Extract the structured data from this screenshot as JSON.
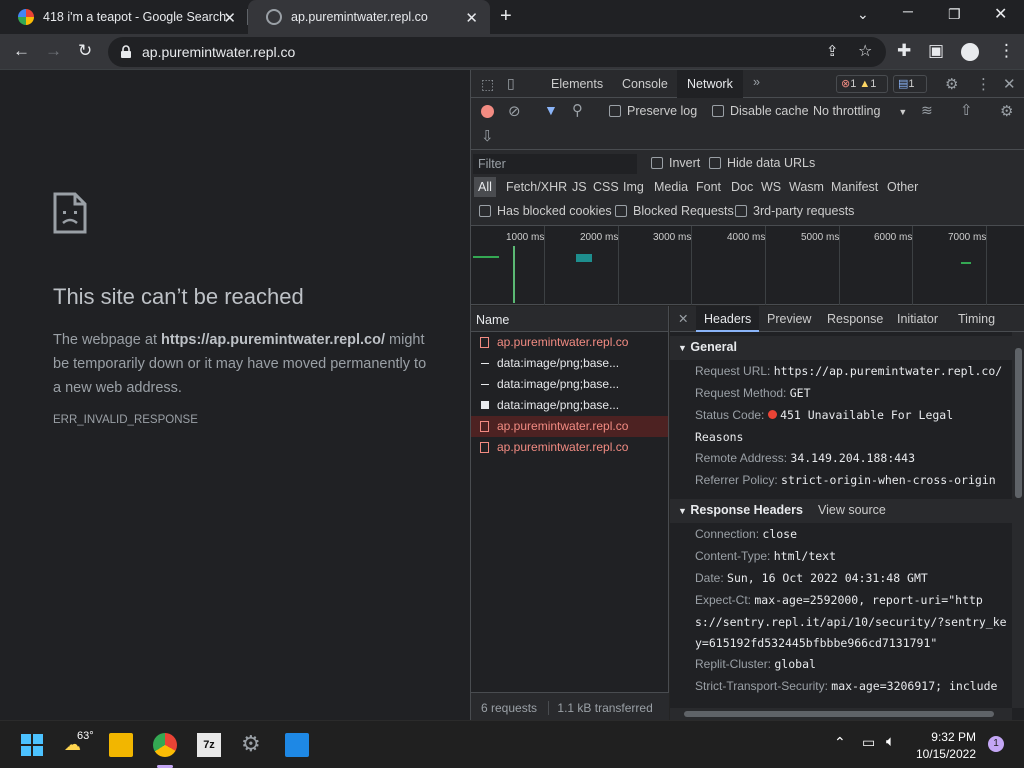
{
  "tabs": [
    {
      "title": "418 i'm a teapot - Google Search"
    },
    {
      "title": "ap.puremintwater.repl.co"
    }
  ],
  "toolbar": {
    "url": "ap.puremintwater.repl.co"
  },
  "page": {
    "title": "This site can’t be reached",
    "body_prefix": "The webpage at ",
    "body_url": "https://ap.puremintwater.repl.co/",
    "body_suffix": " might be temporarily down or it may have moved permanently to a new web address.",
    "error_code": "ERR_INVALID_RESPONSE"
  },
  "devtools": {
    "tabs": [
      "Elements",
      "Console",
      "Network"
    ],
    "active_tab": "Network",
    "badges": {
      "errors": "1",
      "warnings": "1",
      "messages": "1"
    },
    "toolbar": {
      "preserve_log": "Preserve log",
      "disable_cache": "Disable cache",
      "throttling": "No throttling"
    },
    "filter": {
      "placeholder": "Filter",
      "invert": "Invert",
      "hide_data_urls": "Hide data URLs",
      "types": [
        "All",
        "Fetch/XHR",
        "JS",
        "CSS",
        "Img",
        "Media",
        "Font",
        "Doc",
        "WS",
        "Wasm",
        "Manifest",
        "Other"
      ],
      "has_blocked_cookies": "Has blocked cookies",
      "blocked_requests": "Blocked Requests",
      "third_party": "3rd-party requests"
    },
    "timeline": {
      "ticks": [
        "1000 ms",
        "2000 ms",
        "3000 ms",
        "4000 ms",
        "5000 ms",
        "6000 ms",
        "7000 ms"
      ]
    },
    "requests": {
      "header": "Name",
      "items": [
        {
          "name": "ap.puremintwater.repl.co",
          "kind": "error"
        },
        {
          "name": "data:image/png;base...",
          "kind": "data"
        },
        {
          "name": "data:image/png;base...",
          "kind": "data"
        },
        {
          "name": "data:image/png;base...",
          "kind": "data-white"
        },
        {
          "name": "ap.puremintwater.repl.co",
          "kind": "error-selected"
        },
        {
          "name": "ap.puremintwater.repl.co",
          "kind": "error"
        }
      ],
      "summary_count": "6 requests",
      "summary_transfer": "1.1 kB transferred"
    },
    "detail": {
      "tabs": [
        "Headers",
        "Preview",
        "Response",
        "Initiator",
        "Timing"
      ],
      "general_title": "General",
      "general": [
        {
          "key": "Request URL:",
          "value": "https://ap.puremintwater.repl.co/"
        },
        {
          "key": "Request Method:",
          "value": "GET"
        },
        {
          "key": "Status Code:",
          "value": "451 Unavailable For Legal Reasons"
        },
        {
          "key": "Remote Address:",
          "value": "34.149.204.188:443"
        },
        {
          "key": "Referrer Policy:",
          "value": "strict-origin-when-cross-origin"
        }
      ],
      "response_title": "Response Headers",
      "view_source": "View source",
      "response": [
        {
          "key": "Connection:",
          "value": "close"
        },
        {
          "key": "Content-Type:",
          "value": "html/text"
        },
        {
          "key": "Date:",
          "value": "Sun, 16 Oct 2022 04:31:48 GMT"
        },
        {
          "key": "Expect-Ct:",
          "value": "max-age=2592000, report-uri=\"https://sentry.repl.it/api/10/security/?sentry_key=615192fd532445bfbbbe966cd7131791\""
        },
        {
          "key": "Replit-Cluster:",
          "value": "global"
        },
        {
          "key": "Strict-Transport-Security:",
          "value": "max-age=3206917; include"
        }
      ]
    }
  },
  "taskbar": {
    "weather": "63°",
    "time": "9:32 PM",
    "date": "10/15/2022",
    "notifications": "1"
  },
  "colors": {
    "error": "#f28b82",
    "accent": "#8ab4f8",
    "status_dot": "#ea4335"
  }
}
